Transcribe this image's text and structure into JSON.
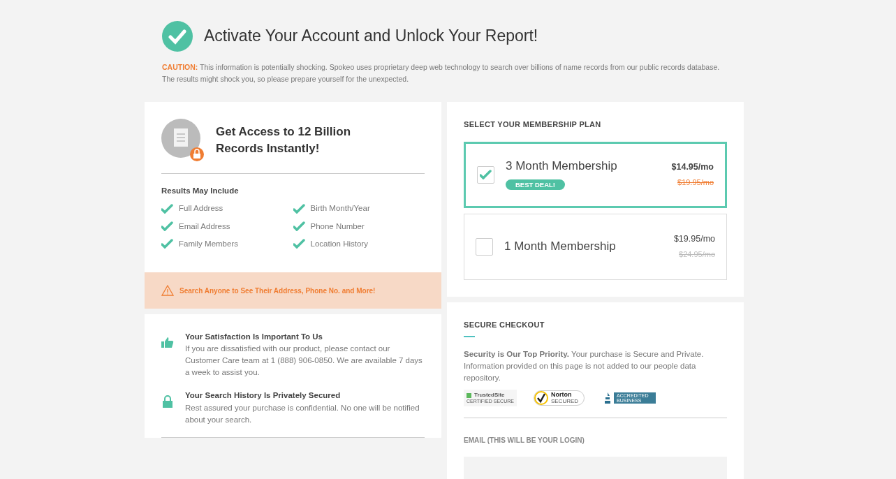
{
  "header": {
    "title": "Activate Your Account and Unlock Your Report!",
    "caution_label": "CAUTION:",
    "caution_text": "This information is potentially shocking. Spokeo uses proprietary deep web technology to search over billions of name records from our public records database. The results might shock you, so please prepare yourself for the unexpected."
  },
  "access": {
    "title": "Get Access to 12 Billion Records Instantly!",
    "results_heading": "Results May Include",
    "results": [
      "Full Address",
      "Birth Month/Year",
      "Email Address",
      "Phone Number",
      "Family Members",
      "Location History"
    ]
  },
  "banner": {
    "text": "Search Anyone to See Their Address, Phone No. and More!"
  },
  "assurances": [
    {
      "kind": "thumb",
      "title": "Your Satisfaction Is Important To Us",
      "text": "If you are dissatisfied with our product, please contact our Customer Care team at 1 (888) 906-0850. We are available 7 days a week to assist you."
    },
    {
      "kind": "lock",
      "title": "Your Search History Is Privately Secured",
      "text": "Rest assured your purchase is confidential. No one will be notified about your search."
    }
  ],
  "plans": {
    "heading": "SELECT YOUR MEMBERSHIP PLAN",
    "items": [
      {
        "name": "3 Month Membership",
        "badge": "BEST DEAL!",
        "price": "$14.95/mo",
        "old_price": "$19.95/mo",
        "selected": true
      },
      {
        "name": "1 Month Membership",
        "price": "$19.95/mo",
        "old_price": "$24.95/mo",
        "selected": false
      }
    ]
  },
  "checkout": {
    "heading": "SECURE CHECKOUT",
    "text": "**Security is Our Top Priority.** Your purchase is Secure and Private. Information provided on this page is not added to our people data repository.",
    "seals": [
      {
        "kind": "trustedsite",
        "name": "TrustedSite",
        "caption": "CERTIFIED SECURE"
      },
      {
        "kind": "norton",
        "name": "Norton",
        "caption": "SECURED"
      },
      {
        "kind": "bbb",
        "caption": "ACCREDITED BUSINESS"
      }
    ],
    "email_label": "EMAIL (THIS WILL BE YOUR LOGIN)"
  }
}
